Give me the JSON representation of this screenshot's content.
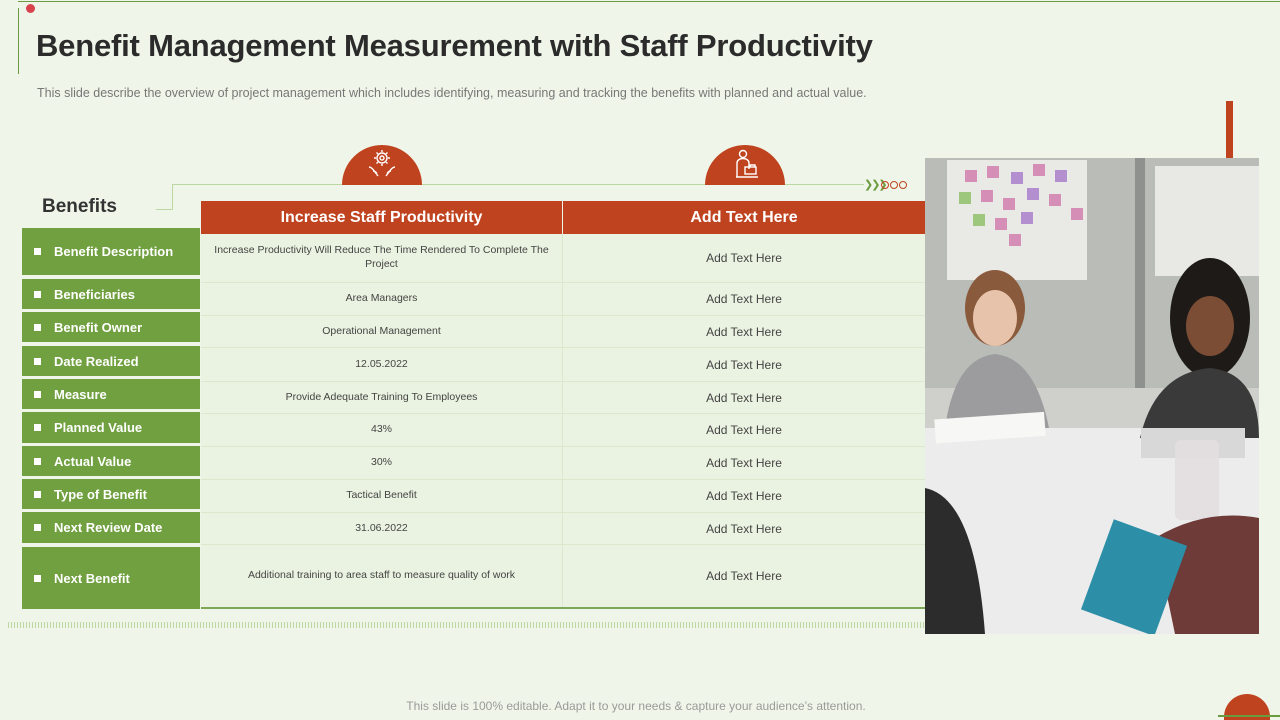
{
  "slide": {
    "title": "Benefit Management Measurement with Staff Productivity",
    "subtitle": "This slide describe the overview  of project management which includes identifying, measuring and tracking the benefits with planned and actual value.",
    "footer": "This slide is 100% editable. Adapt it to your needs & capture your audience’s attention."
  },
  "table": {
    "benefits_heading": "Benefits",
    "columns": [
      "Increase Staff Productivity",
      "Add Text Here"
    ],
    "rows": [
      {
        "label": "Benefit Description",
        "value": "Increase Productivity Will Reduce The Time  Rendered To Complete  The Project",
        "extra": "Add Text Here"
      },
      {
        "label": "Beneficiaries",
        "value": "Area Managers",
        "extra": "Add Text Here"
      },
      {
        "label": "Benefit Owner",
        "value": "Operational Management",
        "extra": "Add Text Here"
      },
      {
        "label": "Date Realized",
        "value": "12.05.2022",
        "extra": "Add Text Here"
      },
      {
        "label": "Measure",
        "value": "Provide Adequate Training To Employees",
        "extra": "Add Text Here"
      },
      {
        "label": "Planned Value",
        "value": "43%",
        "extra": "Add Text Here"
      },
      {
        "label": "Actual Value",
        "value": "30%",
        "extra": "Add Text Here"
      },
      {
        "label": "Type of Benefit",
        "value": "Tactical Benefit",
        "extra": "Add Text Here"
      },
      {
        "label": "Next Review Date",
        "value": "31.06.2022",
        "extra": "Add Text Here"
      },
      {
        "label": "Next Benefit",
        "value": "Additional training to area staff to measure quality of work",
        "extra": "Add Text Here"
      }
    ]
  },
  "icons": {
    "col1": "gear-hands-icon",
    "col2": "person-desk-icon"
  },
  "colors": {
    "accent_orange": "#c0431f",
    "label_green": "#70a03f",
    "background": "#eff6e9"
  }
}
